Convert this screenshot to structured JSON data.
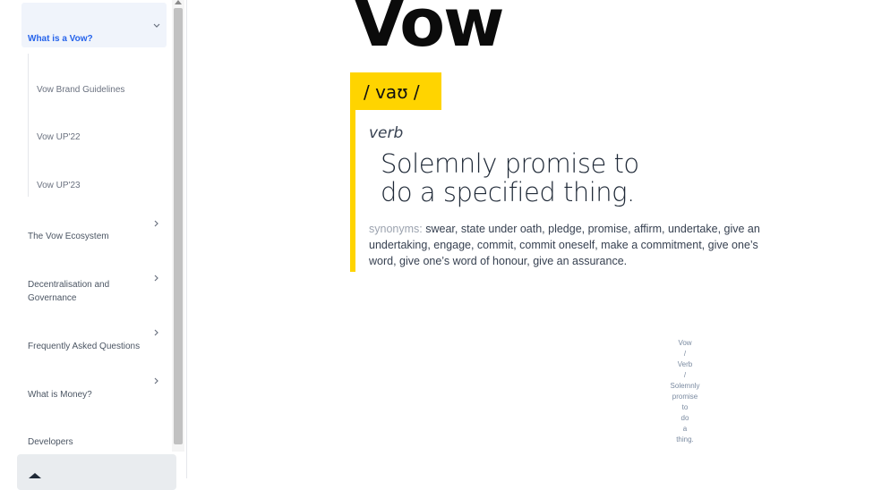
{
  "sidebar": {
    "active_item": "What is a Vow?",
    "sub_items": [
      "Vow Brand Guidelines",
      "Vow UP'22",
      "Vow UP'23"
    ],
    "items": [
      {
        "label": "The Vow Ecosystem"
      },
      {
        "label": "Decentralisation and Governance"
      },
      {
        "label": "Frequently Asked Questions"
      },
      {
        "label": "What is Money?"
      },
      {
        "label": "Developers"
      }
    ]
  },
  "main": {
    "wordmark": "Vow",
    "pronunciation": "/ vaʊ /",
    "part_of_speech": "verb",
    "definition": "Solemnly promise to do a specified thing.",
    "synonyms_label": "synonyms:",
    "synonyms_text": "swear, state under oath, pledge, promise, affirm, undertake, give an undertaking, engage, commit, commit oneself, make a commitment, give one’s word, give one’s word of honour, give an assurance.",
    "image_alt_lines": [
      "Vow",
      "/",
      "Verb",
      "/",
      "Solemnly",
      "promise",
      "to",
      "do",
      "a",
      "thing."
    ]
  },
  "colors": {
    "accent_yellow": "#ffd400",
    "active_blue": "#2563eb"
  }
}
